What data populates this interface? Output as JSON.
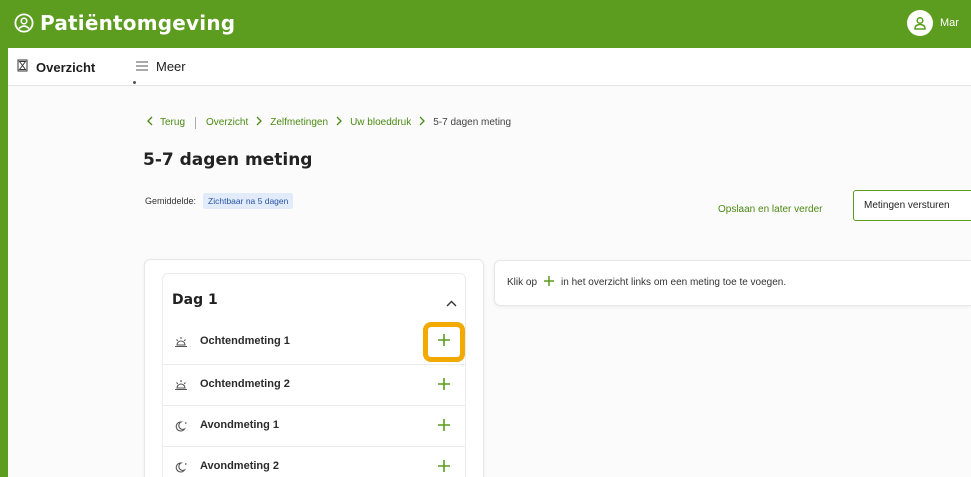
{
  "app": {
    "title": "Patiëntomgeving",
    "user_name": "Mar"
  },
  "subnav": {
    "overzicht_label": "Overzicht",
    "meer_label": "Meer"
  },
  "breadcrumb": {
    "back_label": "Terug",
    "items": [
      "Overzicht",
      "Zelfmetingen",
      "Uw bloeddruk"
    ],
    "current": "5-7 dagen meting"
  },
  "page": {
    "title": "5-7 dagen meting",
    "average_label": "Gemiddelde:",
    "average_badge": "Zichtbaar na 5 dagen",
    "save_later_label": "Opslaan en later verder",
    "send_label": "Metingen versturen"
  },
  "day": {
    "title": "Dag 1",
    "measurements": [
      {
        "label": "Ochtendmeting 1",
        "icon": "sunrise-icon",
        "highlighted": true
      },
      {
        "label": "Ochtendmeting 2",
        "icon": "sunrise-icon",
        "highlighted": false
      },
      {
        "label": "Avondmeting 1",
        "icon": "moon-icon",
        "highlighted": false
      },
      {
        "label": "Avondmeting 2",
        "icon": "moon-icon",
        "highlighted": false
      }
    ]
  },
  "hint": {
    "before": "Klik op",
    "after": "in het overzicht links om een meting toe te voegen."
  },
  "colors": {
    "brand_green": "#5c9c1e",
    "link_green": "#4c8a13",
    "highlight": "#f2a900",
    "badge_bg": "#e1ebfa"
  }
}
